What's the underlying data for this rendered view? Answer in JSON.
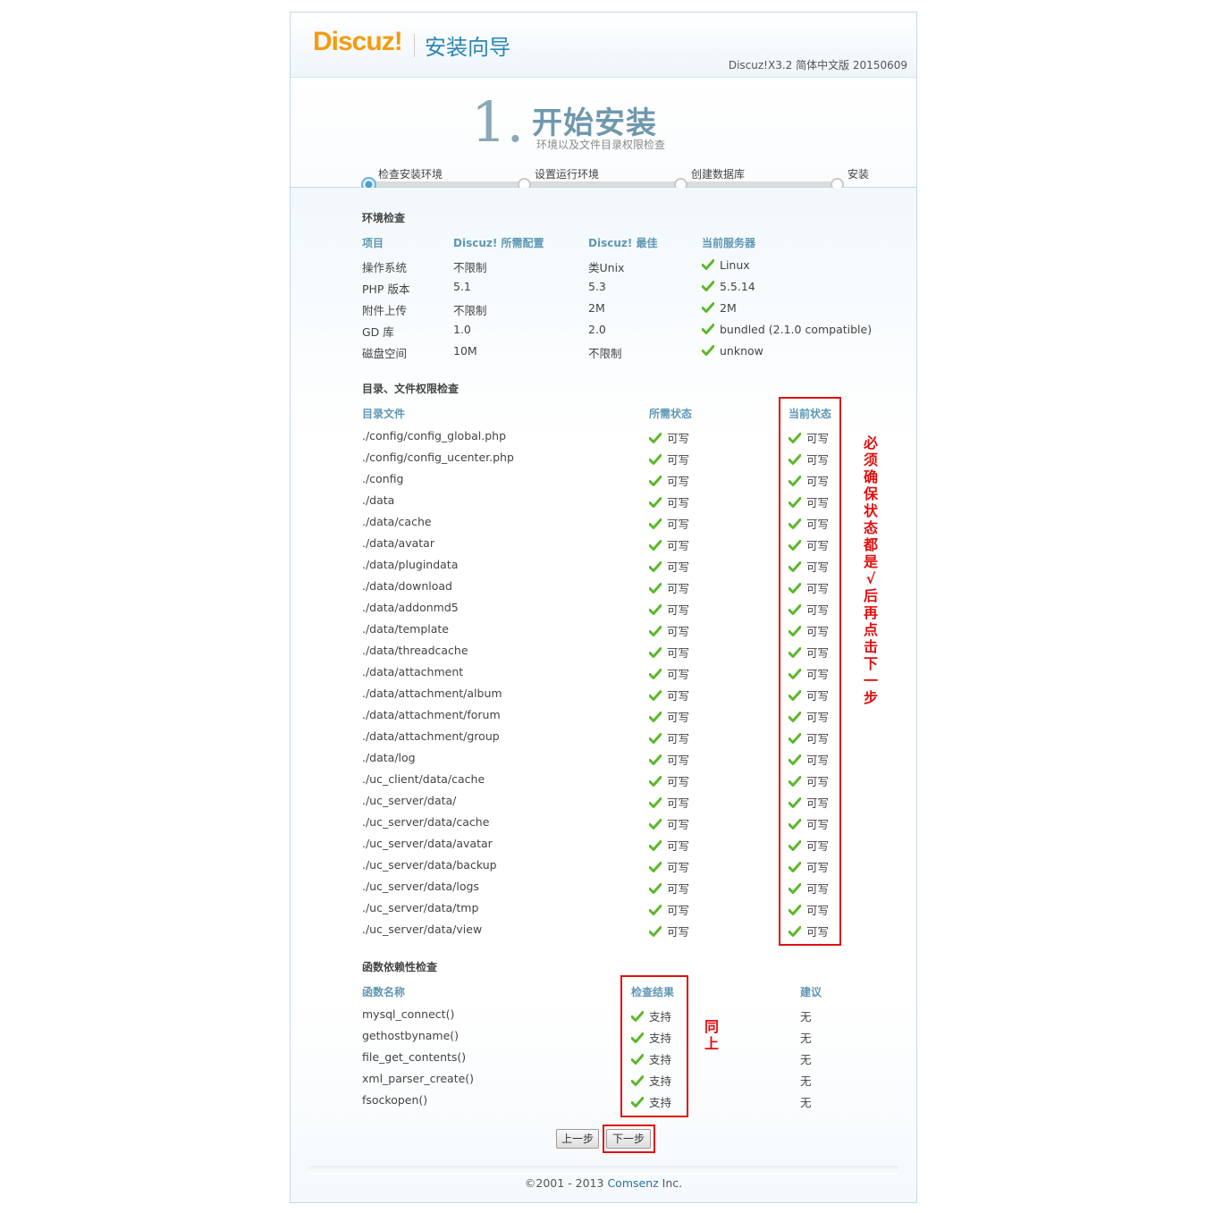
{
  "header": {
    "logo_text": "Discuz!",
    "title": "安装向导",
    "version": "Discuz!X3.2 简体中文版 20150609"
  },
  "step": {
    "number": "1.",
    "title": "开始安装",
    "subtitle": "环境以及文件目录权限检查"
  },
  "progress": {
    "current": 1,
    "steps": [
      "检查安装环境",
      "设置运行环境",
      "创建数据库",
      "安装"
    ]
  },
  "env": {
    "section_title": "环境检查",
    "headers": [
      "项目",
      "Discuz! 所需配置",
      "Discuz! 最佳",
      "当前服务器"
    ],
    "rows": [
      [
        "操作系统",
        "不限制",
        "类Unix",
        "Linux"
      ],
      [
        "PHP 版本",
        "5.1",
        "5.3",
        "5.5.14"
      ],
      [
        "附件上传",
        "不限制",
        "2M",
        "2M"
      ],
      [
        "GD 库",
        "1.0",
        "2.0",
        "bundled (2.1.0 compatible)"
      ],
      [
        "磁盘空间",
        "10M",
        "不限制",
        "unknow"
      ]
    ]
  },
  "dirs": {
    "section_title": "目录、文件权限检查",
    "headers": [
      "目录文件",
      "所需状态",
      "当前状态"
    ],
    "status_text": "可写",
    "rows": [
      "./config/config_global.php",
      "./config/config_ucenter.php",
      "./config",
      "./data",
      "./data/cache",
      "./data/avatar",
      "./data/plugindata",
      "./data/download",
      "./data/addonmd5",
      "./data/template",
      "./data/threadcache",
      "./data/attachment",
      "./data/attachment/album",
      "./data/attachment/forum",
      "./data/attachment/group",
      "./data/log",
      "./uc_client/data/cache",
      "./uc_server/data/",
      "./uc_server/data/cache",
      "./uc_server/data/avatar",
      "./uc_server/data/backup",
      "./uc_server/data/logs",
      "./uc_server/data/tmp",
      "./uc_server/data/view"
    ]
  },
  "funcs": {
    "section_title": "函数依赖性检查",
    "headers": [
      "函数名称",
      "检查结果",
      "建议"
    ],
    "result_text": "支持",
    "suggest_text": "无",
    "rows": [
      "mysql_connect()",
      "gethostbyname()",
      "file_get_contents()",
      "xml_parser_create()",
      "fsockopen()"
    ]
  },
  "annotations": {
    "note1": "必须确保状态都是√后再点击下一步",
    "note2": "同上"
  },
  "buttons": {
    "prev": "上一步",
    "next": "下一步"
  },
  "footer": {
    "prefix": "©2001 - 2013 ",
    "brand": "Comsenz",
    "suffix": " Inc."
  },
  "colors": {
    "accent": "#2b86b6",
    "header_text": "#5f97b4",
    "check": "#5cb82a",
    "annotation": "#e01010",
    "logo": "#f39c12"
  }
}
